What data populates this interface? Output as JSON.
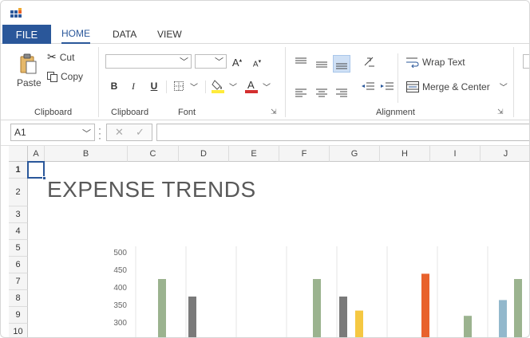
{
  "tabs": {
    "file": "FILE",
    "home": "HOME",
    "data": "DATA",
    "view": "VIEW"
  },
  "clipboard": {
    "cut": "Cut",
    "copy": "Copy",
    "paste": "Paste",
    "group_label": "Clipboard"
  },
  "font": {
    "clipboard_label": "Clipboard",
    "group_label": "Font",
    "name_value": "",
    "size_value": ""
  },
  "alignment": {
    "wrap_text": "Wrap Text",
    "merge_center": "Merge & Center",
    "group_label": "Alignment"
  },
  "formula_bar": {
    "cell_ref": "A1",
    "formula_value": ""
  },
  "columns": [
    "A",
    "B",
    "C",
    "D",
    "E",
    "F",
    "G",
    "H",
    "I",
    "J"
  ],
  "rows": [
    "1",
    "2",
    "3",
    "4",
    "5",
    "6",
    "7",
    "8",
    "9",
    "10"
  ],
  "sheet_title": "EXPENSE TRENDS",
  "colors": {
    "accent": "#2a579a",
    "bar_green": "#9bb38f",
    "bar_gray": "#7a7a7a",
    "bar_yellow": "#f5c842",
    "bar_orange": "#e8622c",
    "bar_blue": "#92b8cc"
  },
  "chart_data": {
    "type": "bar",
    "yticks": [
      300,
      350,
      400,
      450,
      500
    ],
    "ylim": [
      300,
      500
    ],
    "bars": [
      {
        "value": 425,
        "color": "green"
      },
      {
        "value": 375,
        "color": "gray"
      },
      {
        "value": 425,
        "color": "green"
      },
      {
        "value": 375,
        "color": "gray"
      },
      {
        "value": 335,
        "color": "yellow"
      },
      {
        "value": 440,
        "color": "orange"
      },
      {
        "value": 320,
        "color": "green"
      },
      {
        "value": 365,
        "color": "blue"
      },
      {
        "value": 425,
        "color": "green"
      }
    ]
  }
}
